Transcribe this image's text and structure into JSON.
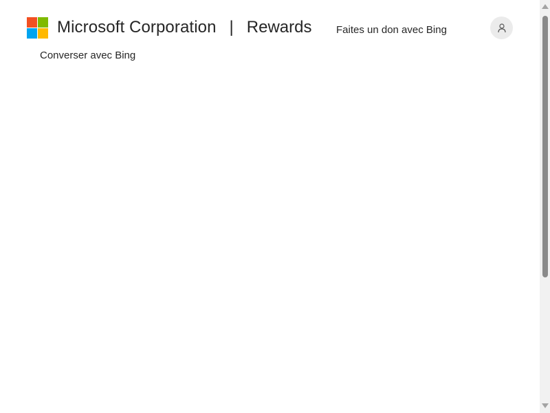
{
  "header": {
    "brand": "Microsoft Corporation",
    "separator": "|",
    "product": "Rewards",
    "logo_colors": [
      "#f25022",
      "#7fba00",
      "#00a4ef",
      "#ffb900"
    ]
  },
  "nav": {
    "donate_link": "Faites un don avec Bing",
    "chat_link": "Converser avec Bing"
  },
  "account": {
    "icon": "person-icon"
  }
}
